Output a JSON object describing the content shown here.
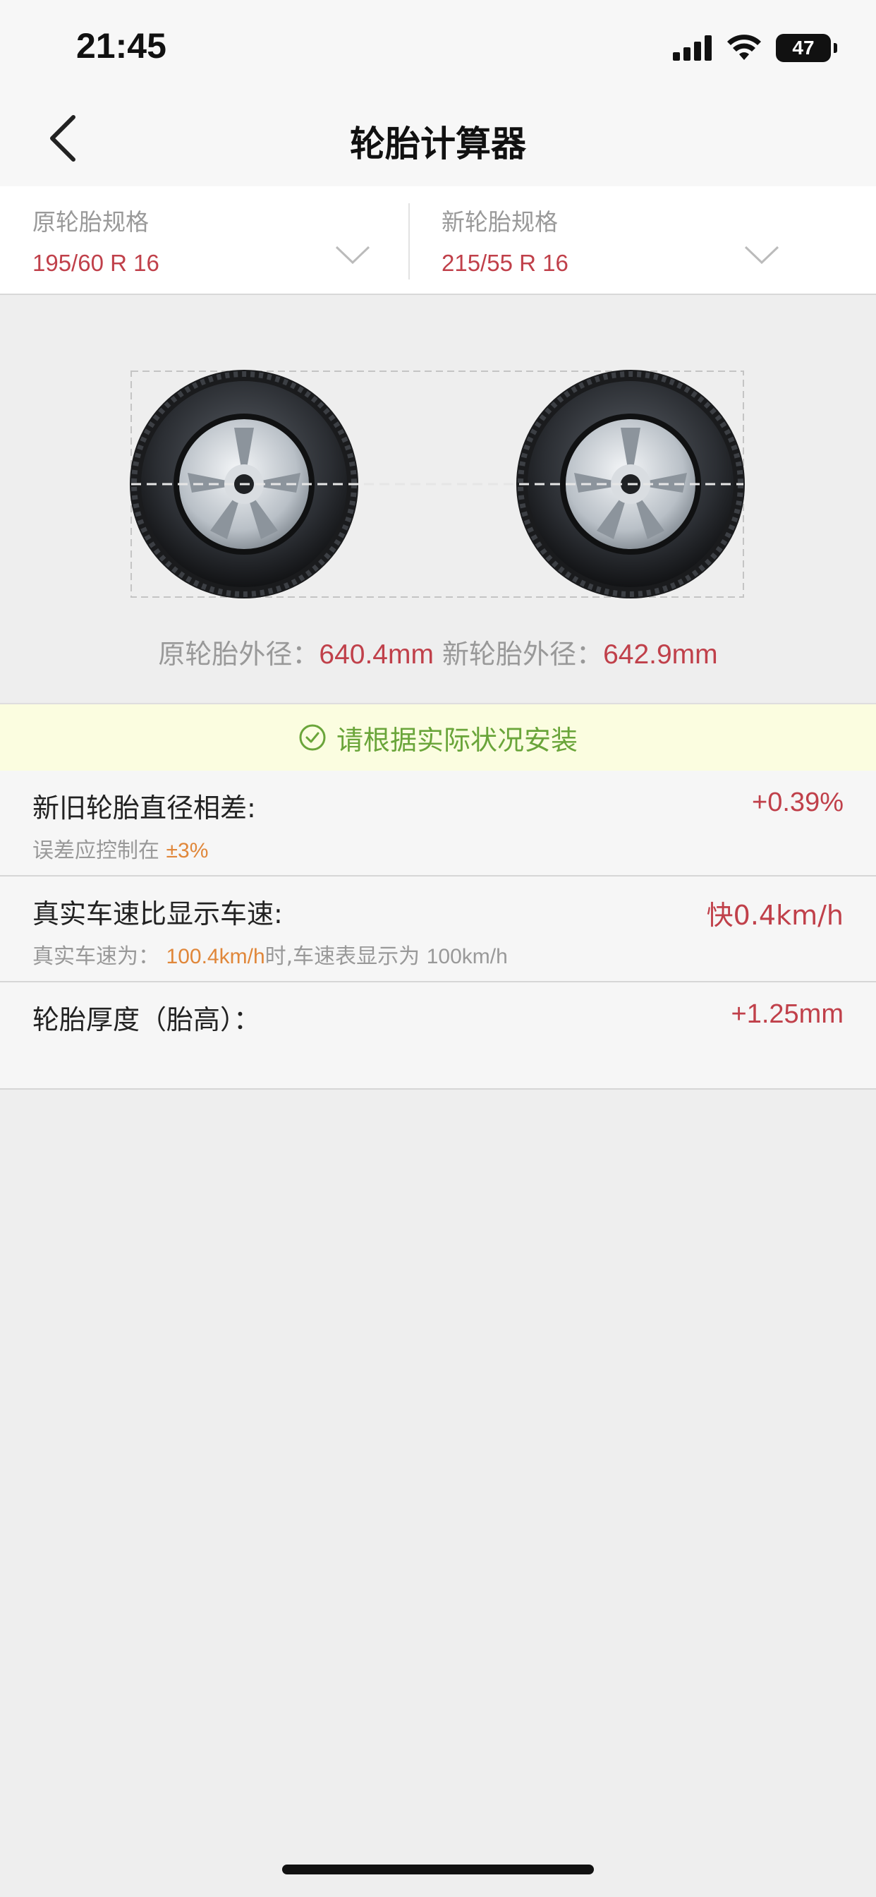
{
  "status_bar": {
    "time": "21:45",
    "battery": "47",
    "icons": [
      "signal-icon",
      "wifi-icon",
      "battery-icon"
    ]
  },
  "nav": {
    "title": "轮胎计算器",
    "back_icon": "chevron-left-icon"
  },
  "spec": {
    "original": {
      "label": "原轮胎规格",
      "value": "195/60 R 16"
    },
    "new": {
      "label": "新轮胎规格",
      "value": "215/55 R 16"
    }
  },
  "diameters": {
    "original_label": "原轮胎外径：",
    "original_value": "640.4mm",
    "new_label": "新轮胎外径：",
    "new_value": "642.9mm"
  },
  "notice": {
    "text": "请根据实际状况安装",
    "icon": "check-circle-icon"
  },
  "results": {
    "diameter_diff": {
      "title": "新旧轮胎直径相差:",
      "value": "+0.39%",
      "sub_prefix": "误差应控制在",
      "sub_highlight": "±3%"
    },
    "speed": {
      "title": "真实车速比显示车速:",
      "value": "快0.4km/h",
      "sub_prefix": "真实车速为：",
      "sub_highlight": "100.4km/h",
      "sub_mid": "时,车速表显示为",
      "sub_suffix": "100km/h"
    },
    "thickness": {
      "title": "轮胎厚度（胎高）：",
      "value": "+1.25mm"
    }
  },
  "colors": {
    "accent_red": "#c0404a",
    "highlight_orange": "#e0873a",
    "notice_green": "#6aa53a",
    "notice_bg": "#fbfde0"
  }
}
